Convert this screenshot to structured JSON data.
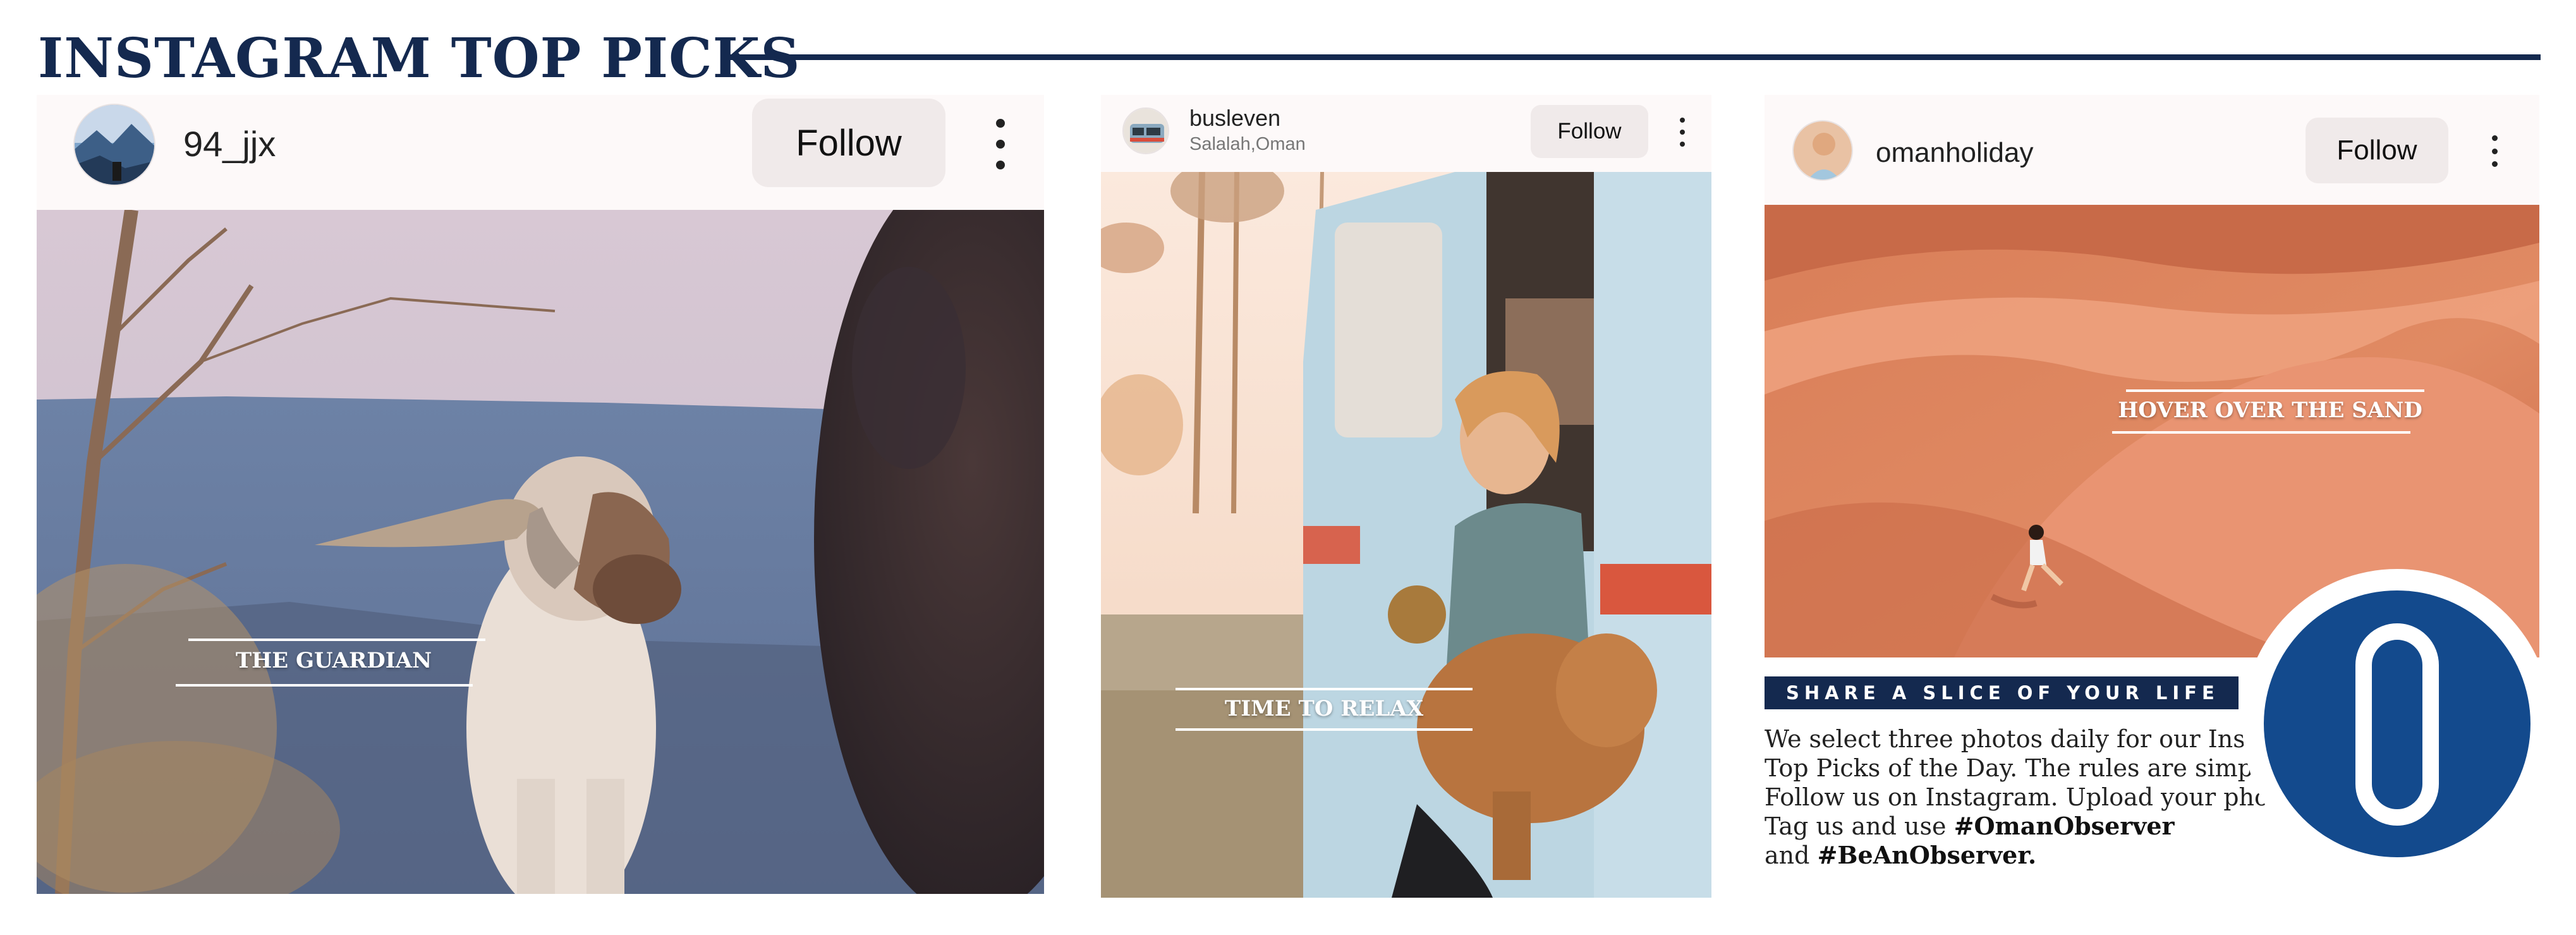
{
  "header": {
    "title": "INSTAGRAM TOP PICKS"
  },
  "posts": [
    {
      "username": "94_jjx",
      "location": "",
      "follow_label": "Follow",
      "caption": "THE GUARDIAN",
      "more_icon": "more-vertical-icon"
    },
    {
      "username": "busleven",
      "location": "Salalah,Oman",
      "follow_label": "Follow",
      "caption": "TIME TO RELAX",
      "more_icon": "more-vertical-icon"
    },
    {
      "username": "omanholiday",
      "location": "",
      "follow_label": "Follow",
      "caption": "HOVER OVER THE SAND",
      "more_icon": "more-vertical-icon"
    }
  ],
  "info": {
    "share_label": "SHARE A SLICE OF YOUR LIFE",
    "text": "We select three photos daily for our Instagram Top Picks of the Day. The rules are simple. Follow us on Instagram. Upload your photos. Tag us and use",
    "hashtag1": "#OmanObserver",
    "and_word": "and",
    "hashtag2": "#BeAnObserver."
  },
  "colors": {
    "navy": "#14294f",
    "logo_blue": "#134a8d",
    "follow_bg": "#f0eaea",
    "card_bg": "#fdf9f9"
  }
}
